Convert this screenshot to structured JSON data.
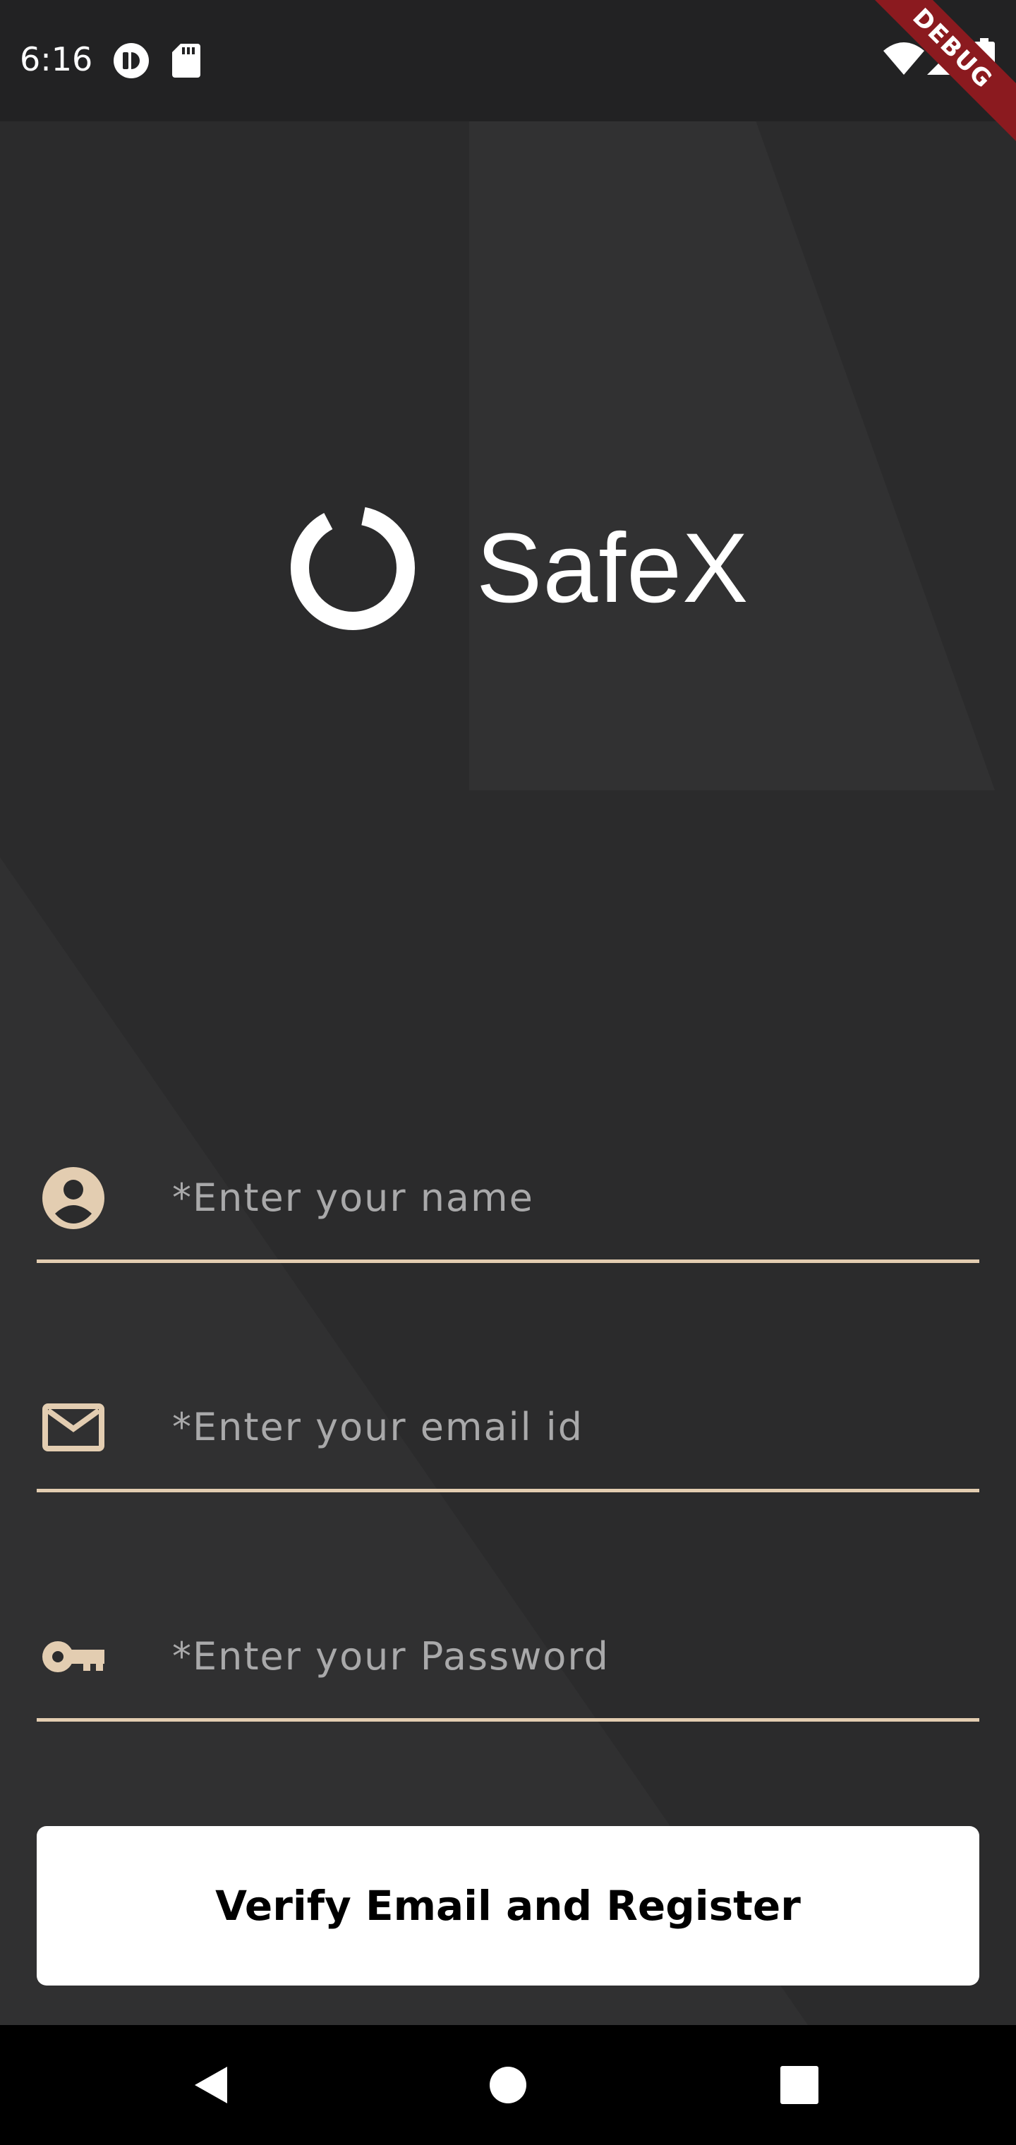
{
  "status_bar": {
    "time": "6:16",
    "icons": [
      "app-notification-icon",
      "sd-card-icon",
      "wifi-icon",
      "cellular-signal-icon",
      "battery-icon"
    ],
    "debug_label": "DEBUG"
  },
  "brand": {
    "app_name": "SafeX",
    "logo_icon": "ring-logo-icon"
  },
  "form": {
    "name": {
      "placeholder": "*Enter your name",
      "value": "",
      "icon": "account-circle-icon"
    },
    "email": {
      "placeholder": "*Enter your email id",
      "value": "",
      "icon": "mail-icon"
    },
    "password": {
      "placeholder": "*Enter your Password",
      "value": "",
      "icon": "key-icon"
    },
    "submit_label": "Verify Email and Register"
  },
  "navigation": {
    "buttons": [
      "back-icon",
      "home-icon",
      "recents-icon"
    ]
  },
  "colors": {
    "background": "#2b2b2c",
    "accent": "#e3cdb1",
    "button_bg": "#ffffff",
    "debug_banner": "#8b1a1f"
  }
}
